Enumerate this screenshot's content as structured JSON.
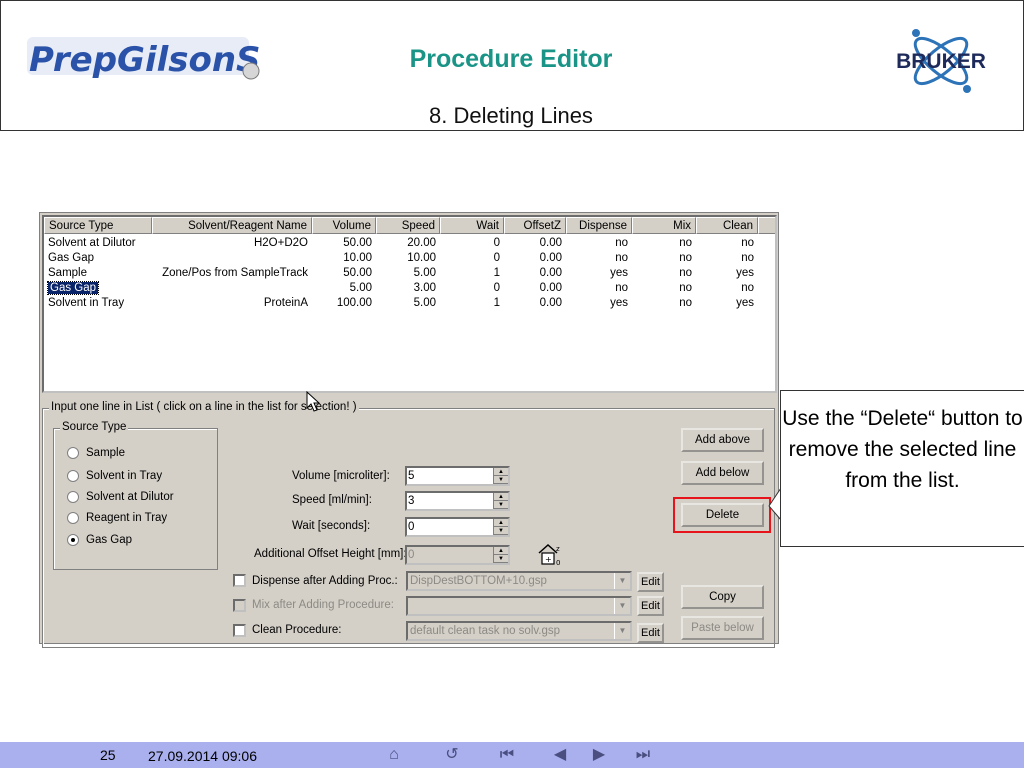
{
  "header": {
    "title": "Procedure Editor",
    "subtitle": "8. Deleting Lines",
    "logo_left_text": "PrepGilsonST",
    "logo_right_text": "BRUKER"
  },
  "listview": {
    "columns": [
      "Source Type",
      "Solvent/Reagent Name",
      "Volume",
      "Speed",
      "Wait",
      "OffsetZ",
      "Dispense",
      "Mix",
      "Clean"
    ],
    "rows": [
      [
        "Solvent at Dilutor",
        "H2O+D2O",
        "50.00",
        "20.00",
        "0",
        "0.00",
        "no",
        "no",
        "no"
      ],
      [
        "Gas Gap",
        "",
        "10.00",
        "10.00",
        "0",
        "0.00",
        "no",
        "no",
        "no"
      ],
      [
        "Sample",
        "Zone/Pos from SampleTrack",
        "50.00",
        "5.00",
        "1",
        "0.00",
        "yes",
        "no",
        "yes"
      ],
      [
        "Gas Gap",
        "",
        "5.00",
        "3.00",
        "0",
        "0.00",
        "no",
        "no",
        "no"
      ],
      [
        "Solvent in Tray",
        "ProteinA",
        "100.00",
        "5.00",
        "1",
        "0.00",
        "yes",
        "no",
        "yes"
      ]
    ],
    "selected_row": 3
  },
  "input_group": {
    "label": "Input one line in List ( click on a line in the list for selection! )"
  },
  "source_type": {
    "label": "Source Type",
    "options": [
      "Sample",
      "Solvent in Tray",
      "Solvent at Dilutor",
      "Reagent in Tray",
      "Gas Gap"
    ],
    "selected": "Gas Gap"
  },
  "fields": {
    "volume_label": "Volume [microliter]:",
    "volume_value": "5",
    "speed_label": "Speed [ml/min]:",
    "speed_value": "3",
    "wait_label": "Wait [seconds]:",
    "wait_value": "0",
    "offset_label": "Additional Offset Height [mm]:",
    "offset_value": "0"
  },
  "procedures": {
    "dispense_label": "Dispense after Adding  Proc.:",
    "dispense_value": "DispDestBOTTOM+10.gsp",
    "mix_label": "Mix after Adding   Procedure:",
    "mix_value": "",
    "clean_label": "Clean  Procedure:",
    "clean_value": "default clean task no solv.gsp",
    "edit_label": "Edit"
  },
  "buttons": {
    "add_above": "Add above",
    "add_below": "Add below",
    "delete": "Delete",
    "copy": "Copy",
    "paste_below": "Paste below"
  },
  "callout": {
    "text": "Use the “Delete“ button to remove the selected line from the list."
  },
  "footer": {
    "page_number": "25",
    "date": "27.09.2014 09:06"
  },
  "colors": {
    "title": "#1a9486",
    "highlight": "#e8141c",
    "footer_bg": "#aab0ee",
    "selection": "#0a246a"
  }
}
